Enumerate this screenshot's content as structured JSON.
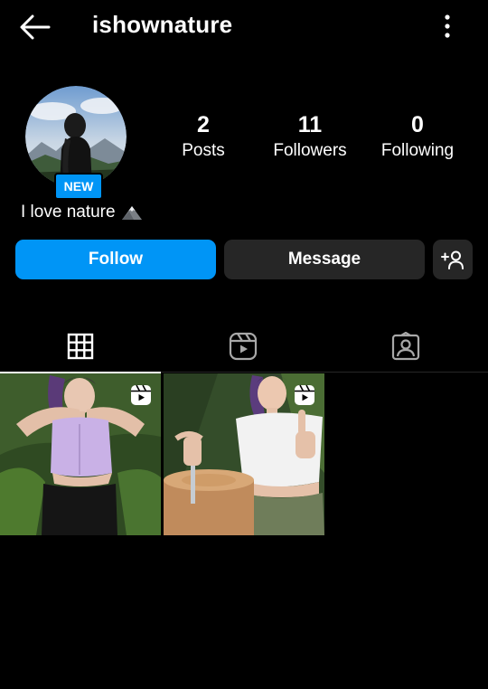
{
  "header": {
    "username": "ishownature",
    "back_icon": "arrow-left-icon",
    "more_icon": "more-vertical-icon"
  },
  "profile": {
    "badge": "NEW",
    "bio": "I love nature",
    "bio_emoji": "mountain-icon",
    "stats": [
      {
        "value": "2",
        "label": "Posts"
      },
      {
        "value": "11",
        "label": "Followers"
      },
      {
        "value": "0",
        "label": "Following"
      }
    ]
  },
  "actions": {
    "follow": "Follow",
    "message": "Message",
    "add_user_icon": "add-user-icon"
  },
  "tabs": [
    {
      "icon": "grid-icon",
      "active": true
    },
    {
      "icon": "reels-icon",
      "active": false
    },
    {
      "icon": "tagged-icon",
      "active": false
    }
  ],
  "posts": [
    {
      "type": "reel",
      "icon": "reel-icon"
    },
    {
      "type": "reel",
      "icon": "reel-icon"
    }
  ],
  "colors": {
    "accent": "#0095f6",
    "background": "#000000",
    "button_secondary": "#262626",
    "text": "#ffffff"
  }
}
